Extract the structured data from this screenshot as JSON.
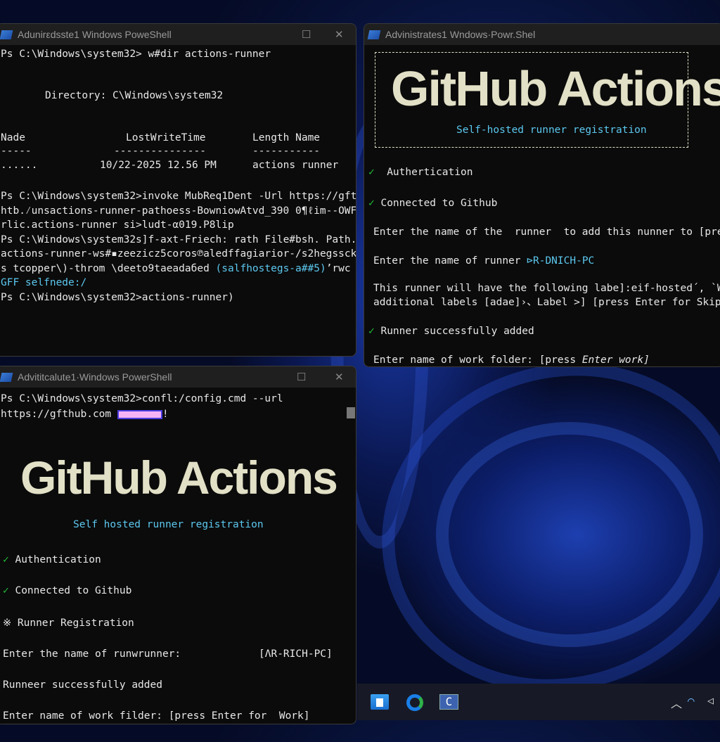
{
  "window1": {
    "title": "Adunirεdsste1 Windows PoweShell",
    "lines": [
      "Ps C:\\Windows\\system32> w#dir actions-runner",
      "Directory: C\\Windows\\system32"
    ],
    "table": {
      "headers": [
        "Nade",
        "LostWriteTime",
        "Length Name"
      ],
      "dashes": [
        "-----",
        "---------------",
        "-----------"
      ],
      "row": [
        "......",
        "10/22-2025 12.56 PM",
        "actions runner"
      ]
    },
    "cmd": [
      "Ps C:\\Windows\\system32>invoke MubReq1Dent -Url https://gft",
      "htb.⁄unsactions-runner-pathoess-BowniowAtvd_390 0¶ℓim--OWF",
      "rlic.actions-runner si>ludt-α019.P8lip",
      "Ps C:\\Windows\\system32s]f-axt-Friech: rath File#bsh. Path.",
      "actions-runner-ws#▪zeezicz5coros℗aledffagiarior-/s2hegssck",
      "s tcopper\\)-throm \\deeto9taeadaбed ",
      "(salfhostegs-a##5)",
      "’rwc",
      "GFF selfnede:/",
      "Ps C:\\Windows\\system32>actions-runner)"
    ]
  },
  "window2": {
    "title": "Advinistrates1 Wndows·Powr.Shel",
    "logo": "GitHub Actions",
    "subtitle": "Self-hosted runner registration",
    "lines": [
      "Authertication",
      "Connected to Github",
      "Enter the name of the  runner  to add this nunner to [press E",
      "Enter the name of runner ",
      "⊳R-DNICH-PC",
      "This runner will have the following labe]:eif-hosted´, `Wâmb",
      "additional labels [adae]›、Label >] [press Enter for Skip]",
      "Runner successfully added",
      "Enter name of work folder: [press ",
      "Enter work]"
    ]
  },
  "window3": {
    "title": "Advititcalute1·Windows PowerShell",
    "cmd": [
      "Ps C:\\Windows\\system32>confl:/config.cmd --url",
      "https://gfthub.com ",
      "!"
    ],
    "logo": "GitHub Actions",
    "subtitle": "Self hosted runner registration",
    "lines": [
      "Authentication",
      "Connected to Github",
      "Runner Registration",
      "Enter the name of runwrunner:",
      "[ΛR-RICH-PC]",
      "Runneer successfully added",
      "Enter name of work filder: [press Enter for  Work]"
    ]
  },
  "icons": {
    "check": "✓",
    "spinner": "※",
    "close": "✕",
    "max": "☐"
  }
}
